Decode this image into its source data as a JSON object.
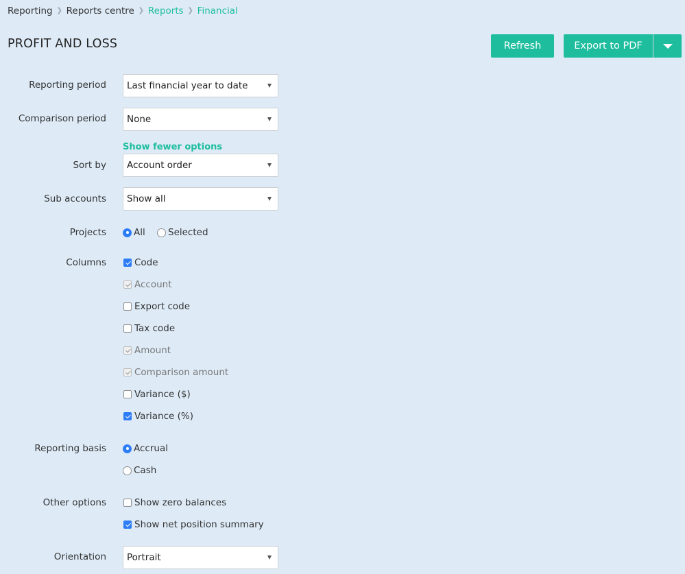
{
  "breadcrumb": [
    {
      "label": "Reporting",
      "active": false
    },
    {
      "label": "Reports centre",
      "active": false
    },
    {
      "label": "Reports",
      "active": true
    },
    {
      "label": "Financial",
      "active": true
    }
  ],
  "page_title": "PROFIT AND LOSS",
  "actions": {
    "refresh": "Refresh",
    "export": "Export to PDF",
    "export_menu_icon": "caret-down-icon"
  },
  "form": {
    "reporting_period": {
      "label": "Reporting period",
      "value": "Last financial year to date"
    },
    "comparison_period": {
      "label": "Comparison period",
      "value": "None"
    },
    "show_fewer": "Show fewer options",
    "sort_by": {
      "label": "Sort by",
      "value": "Account order"
    },
    "sub_accounts": {
      "label": "Sub accounts",
      "value": "Show all"
    },
    "projects": {
      "label": "Projects",
      "options": [
        {
          "label": "All",
          "selected": true
        },
        {
          "label": "Selected",
          "selected": false
        }
      ]
    },
    "columns": {
      "label": "Columns",
      "options": [
        {
          "label": "Code",
          "checked": true,
          "disabled": false
        },
        {
          "label": "Account",
          "checked": true,
          "disabled": true
        },
        {
          "label": "Export code",
          "checked": false,
          "disabled": false
        },
        {
          "label": "Tax code",
          "checked": false,
          "disabled": false
        },
        {
          "label": "Amount",
          "checked": true,
          "disabled": true
        },
        {
          "label": "Comparison amount",
          "checked": true,
          "disabled": true
        },
        {
          "label": "Variance ($)",
          "checked": false,
          "disabled": false
        },
        {
          "label": "Variance (%)",
          "checked": true,
          "disabled": false
        }
      ]
    },
    "reporting_basis": {
      "label": "Reporting basis",
      "options": [
        {
          "label": "Accrual",
          "selected": true
        },
        {
          "label": "Cash",
          "selected": false
        }
      ]
    },
    "other_options": {
      "label": "Other options",
      "options": [
        {
          "label": "Show zero balances",
          "checked": false
        },
        {
          "label": "Show net position summary",
          "checked": true
        }
      ]
    },
    "orientation": {
      "label": "Orientation",
      "value": "Portrait"
    }
  },
  "colors": {
    "background": "#deebf7",
    "accent": "#1ebd9e",
    "control_blue": "#2e7cf6"
  }
}
